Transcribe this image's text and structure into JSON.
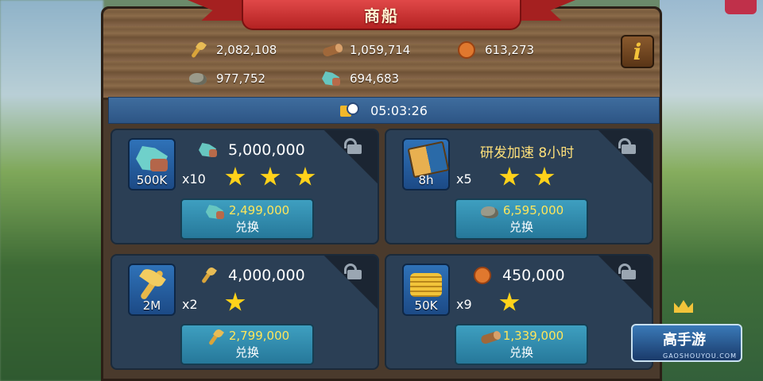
{
  "title": "商船",
  "resources": [
    {
      "icon": "wheat-icon",
      "value": "2,082,108"
    },
    {
      "icon": "wood-log-icon",
      "value": "1,059,714"
    },
    {
      "icon": "gold-coin-icon",
      "value": "613,273"
    },
    {
      "icon": "stone-icon",
      "value": "977,752"
    },
    {
      "icon": "ore-icon",
      "value": "694,683"
    }
  ],
  "info_button": "i",
  "timer": "05:03:26",
  "offers": [
    {
      "item_icon": "ore-pile-icon",
      "item_qty": "500K",
      "multiplier": "x10",
      "stars": 3,
      "reward_icon": "ore-icon",
      "reward": "5,000,000",
      "price_icon": "ore-icon",
      "price": "2,499,000",
      "button": "兑换"
    },
    {
      "item_icon": "speedup-book-icon",
      "item_qty": "8h",
      "multiplier": "x5",
      "stars": 2,
      "reward_icon": "",
      "reward": "研发加速 8小时",
      "price_icon": "stone-icon",
      "price": "6,595,000",
      "button": "兑换"
    },
    {
      "item_icon": "wheat-bundle-icon",
      "item_qty": "2M",
      "multiplier": "x2",
      "stars": 1,
      "reward_icon": "wheat-icon",
      "reward": "4,000,000",
      "price_icon": "wheat-icon",
      "price": "2,799,000",
      "button": "兑换"
    },
    {
      "item_icon": "gold-pile-icon",
      "item_qty": "50K",
      "multiplier": "x9",
      "stars": 1,
      "reward_icon": "gold-coin-icon",
      "reward": "450,000",
      "price_icon": "wood-log-icon",
      "price": "1,339,000",
      "button": "兑换"
    }
  ],
  "watermark": {
    "text": "高手游",
    "sub": "GAOSHOUYOU.COM"
  }
}
